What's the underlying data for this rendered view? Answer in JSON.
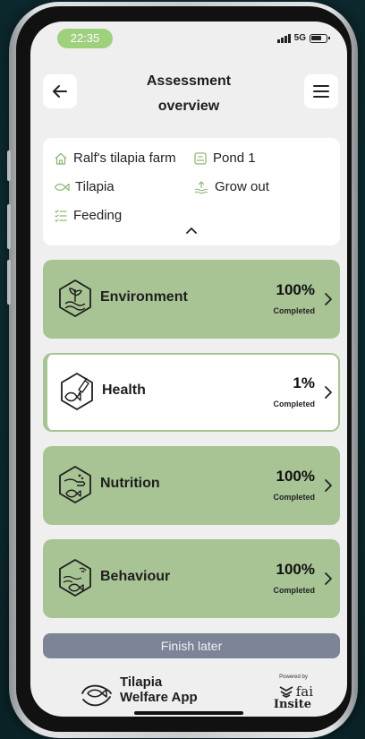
{
  "status_bar": {
    "time": "22:35",
    "network": "5G"
  },
  "header": {
    "title_line1": "Assessment",
    "title_line2": "overview"
  },
  "farm_info": {
    "farm": "Ralf's tilapia farm",
    "pond": "Pond 1",
    "species": "Tilapia",
    "stage": "Grow out",
    "activity": "Feeding"
  },
  "categories": [
    {
      "label": "Environment",
      "percent": "100%",
      "status": "Completed",
      "icon": "environment-icon"
    },
    {
      "label": "Health",
      "percent": "1%",
      "status": "Completed",
      "icon": "health-icon"
    },
    {
      "label": "Nutrition",
      "percent": "100%",
      "status": "Completed",
      "icon": "nutrition-icon"
    },
    {
      "label": "Behaviour",
      "percent": "100%",
      "status": "Completed",
      "icon": "behaviour-icon"
    }
  ],
  "finish_button": {
    "label": "Finish later"
  },
  "footer": {
    "app_name_line1": "Tilapia",
    "app_name_line2": "Welfare App",
    "powered_by": "Powered by",
    "partner_name": "fai",
    "partner_product": "Insite"
  },
  "colors": {
    "accent_green": "#a8c494",
    "time_pill": "#9fd07e",
    "finish_button": "#7e8497",
    "screen_background": "#efefef"
  }
}
